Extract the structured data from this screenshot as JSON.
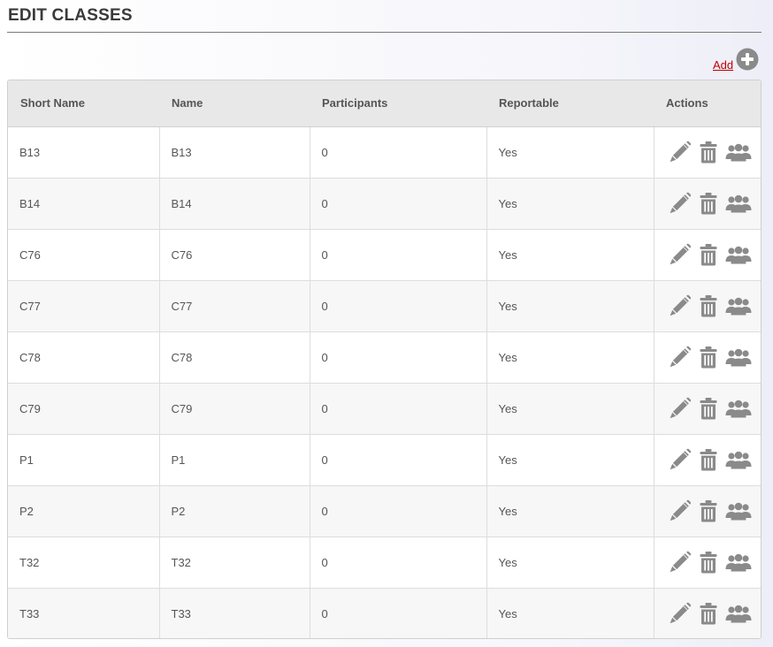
{
  "page": {
    "title": "EDIT CLASSES",
    "add_label": "Add"
  },
  "table": {
    "headers": [
      "Short Name",
      "Name",
      "Participants",
      "Reportable",
      "Actions"
    ],
    "rows": [
      {
        "short_name": "B13",
        "name": "B13",
        "participants": "0",
        "reportable": "Yes"
      },
      {
        "short_name": "B14",
        "name": "B14",
        "participants": "0",
        "reportable": "Yes"
      },
      {
        "short_name": "C76",
        "name": "C76",
        "participants": "0",
        "reportable": "Yes"
      },
      {
        "short_name": "C77",
        "name": "C77",
        "participants": "0",
        "reportable": "Yes"
      },
      {
        "short_name": "C78",
        "name": "C78",
        "participants": "0",
        "reportable": "Yes"
      },
      {
        "short_name": "C79",
        "name": "C79",
        "participants": "0",
        "reportable": "Yes"
      },
      {
        "short_name": "P1",
        "name": "P1",
        "participants": "0",
        "reportable": "Yes"
      },
      {
        "short_name": "P2",
        "name": "P2",
        "participants": "0",
        "reportable": "Yes"
      },
      {
        "short_name": "T32",
        "name": "T32",
        "participants": "0",
        "reportable": "Yes"
      },
      {
        "short_name": "T33",
        "name": "T33",
        "participants": "0",
        "reportable": "Yes"
      }
    ],
    "row_actions": [
      "pencil-icon",
      "trash-icon",
      "people-icon"
    ]
  },
  "colors": {
    "add_link": "#c00000",
    "icon_gray": "#8a8a8a",
    "header_bg": "#e8e8e8",
    "alt_row_bg": "#f7f7f7"
  }
}
